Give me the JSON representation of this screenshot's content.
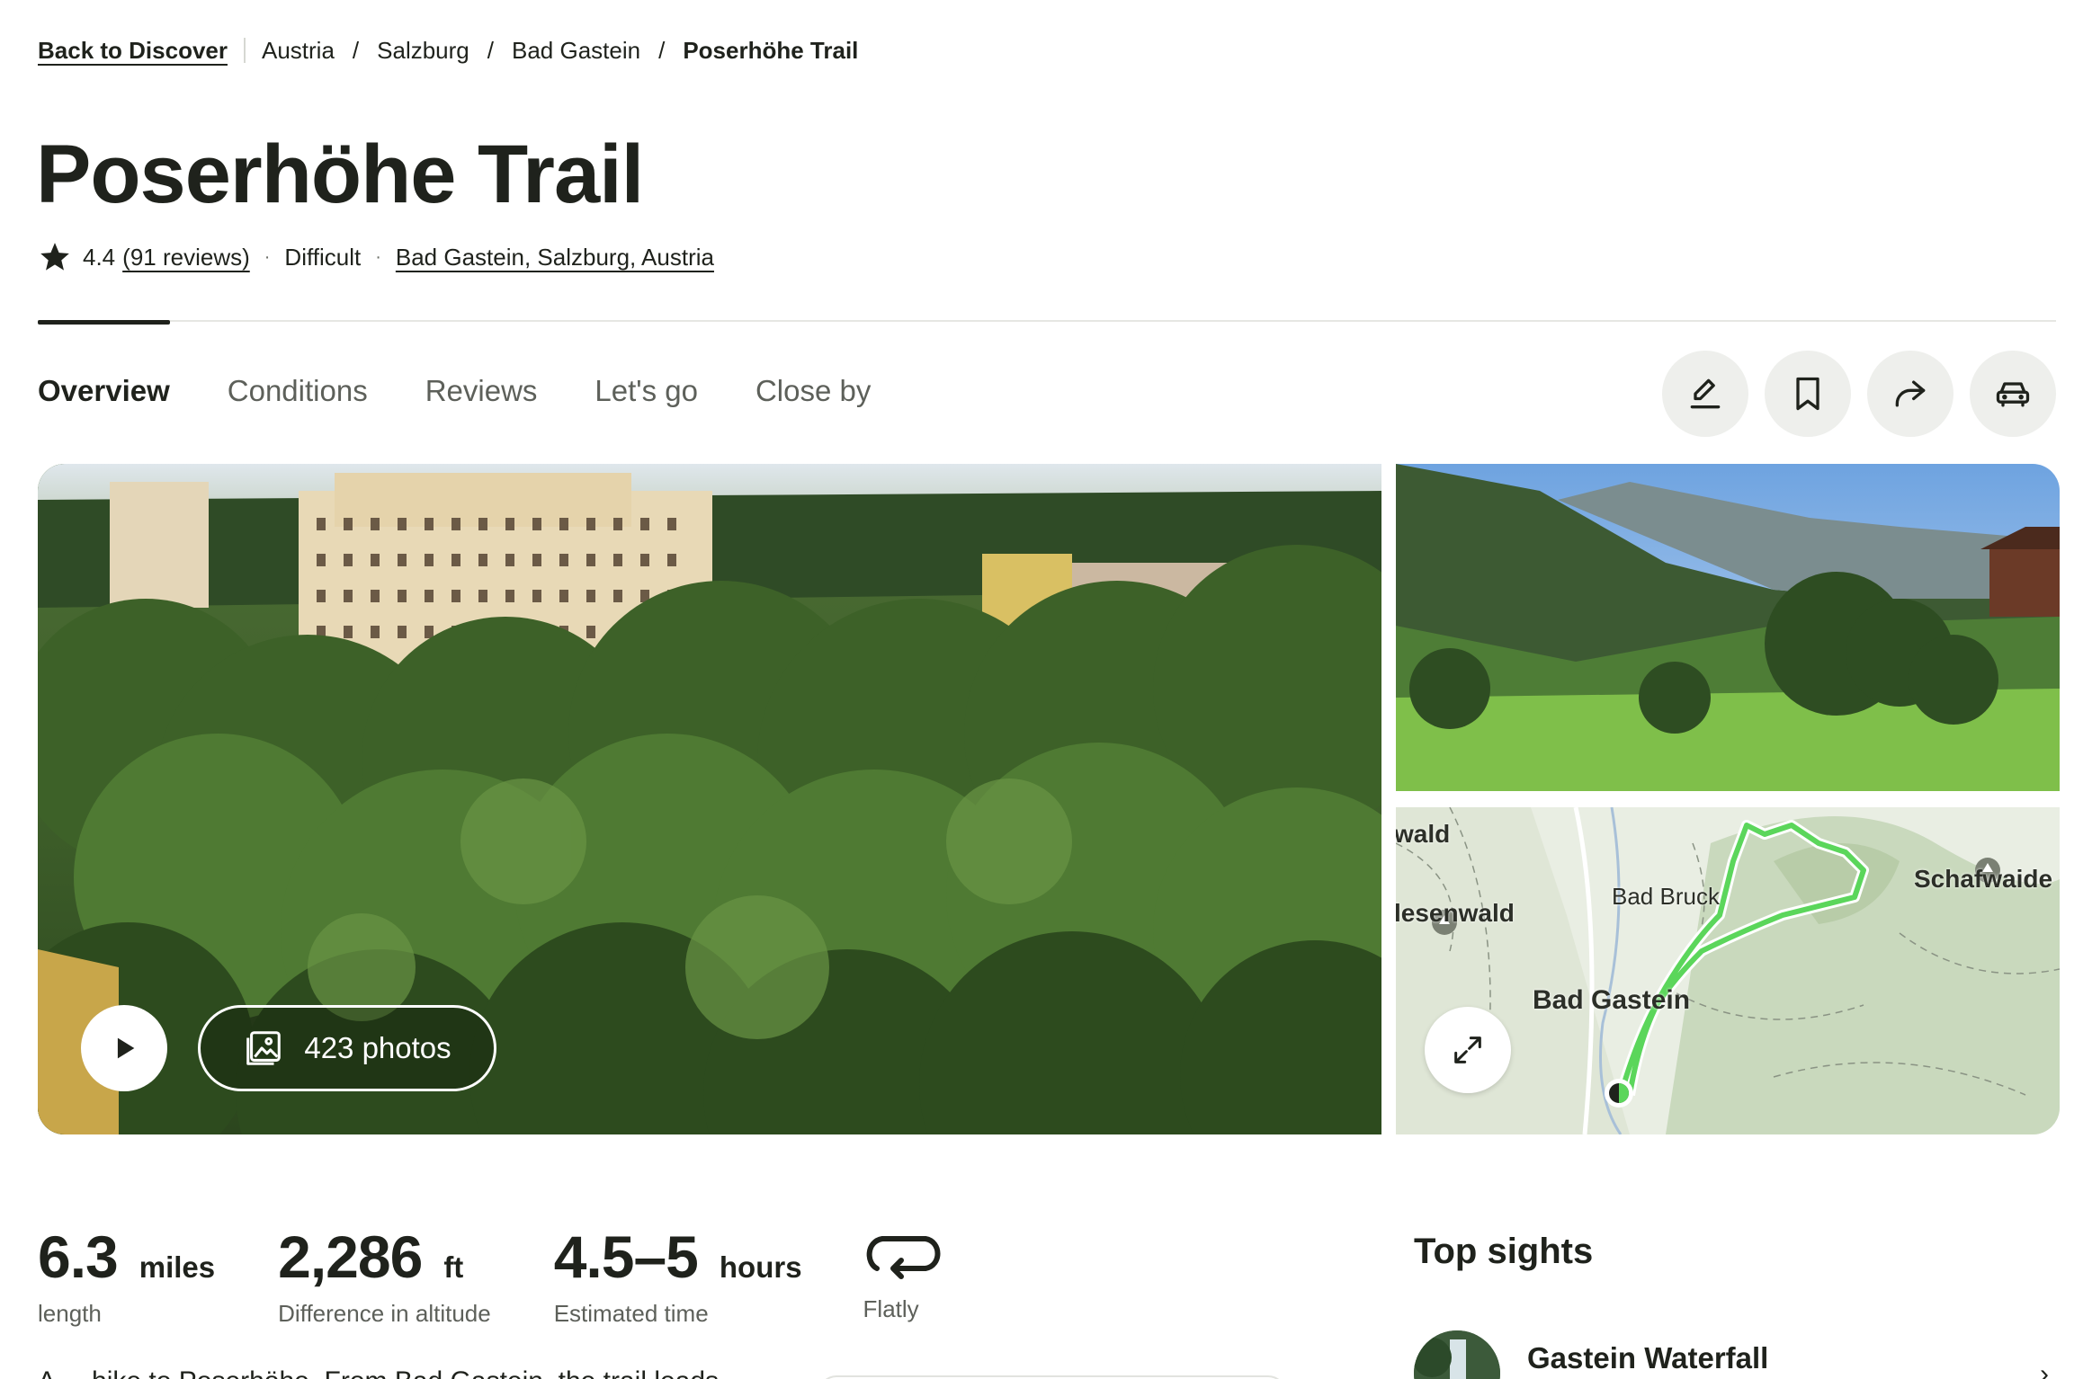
{
  "breadcrumb": {
    "back_label": "Back to Discover",
    "items": [
      "Austria",
      "Salzburg",
      "Bad Gastein"
    ],
    "current": "Poserhöhe Trail"
  },
  "trail": {
    "title": "Poserhöhe Trail",
    "rating": "4.4",
    "reviews_text": "(91 reviews)",
    "difficulty": "Difficult",
    "location": "Bad Gastein, Salzburg, Austria"
  },
  "tabs": [
    "Overview",
    "Conditions",
    "Reviews",
    "Let's go",
    "Close by"
  ],
  "actions": {
    "icons": [
      "pen-icon",
      "bookmark-icon",
      "share-icon",
      "car-icon"
    ]
  },
  "gallery": {
    "photos_label": "423 photos"
  },
  "map": {
    "labels": [
      "wald",
      "lesenwald",
      "Bad Bruck",
      "Schafwaide",
      "Bad Gastein"
    ]
  },
  "stats": [
    {
      "value": "6.3",
      "unit": "miles",
      "label": "length"
    },
    {
      "value": "2,286",
      "unit": "ft",
      "label": "Difference in altitude"
    },
    {
      "value": "4.5–5",
      "unit": "hours",
      "label": "Estimated time"
    }
  ],
  "route_type": "Flatly",
  "top_sights": {
    "heading": "Top sights",
    "items": [
      {
        "name": "Gastein Waterfall"
      }
    ]
  },
  "description": {
    "text": "A ... hike to Poserhöhe. From Bad Gastein, the trail leads"
  },
  "colors": {
    "text": "#1f221c",
    "muted": "#5d605a",
    "button_bg": "#eeefec",
    "route": "#5bd65b"
  }
}
